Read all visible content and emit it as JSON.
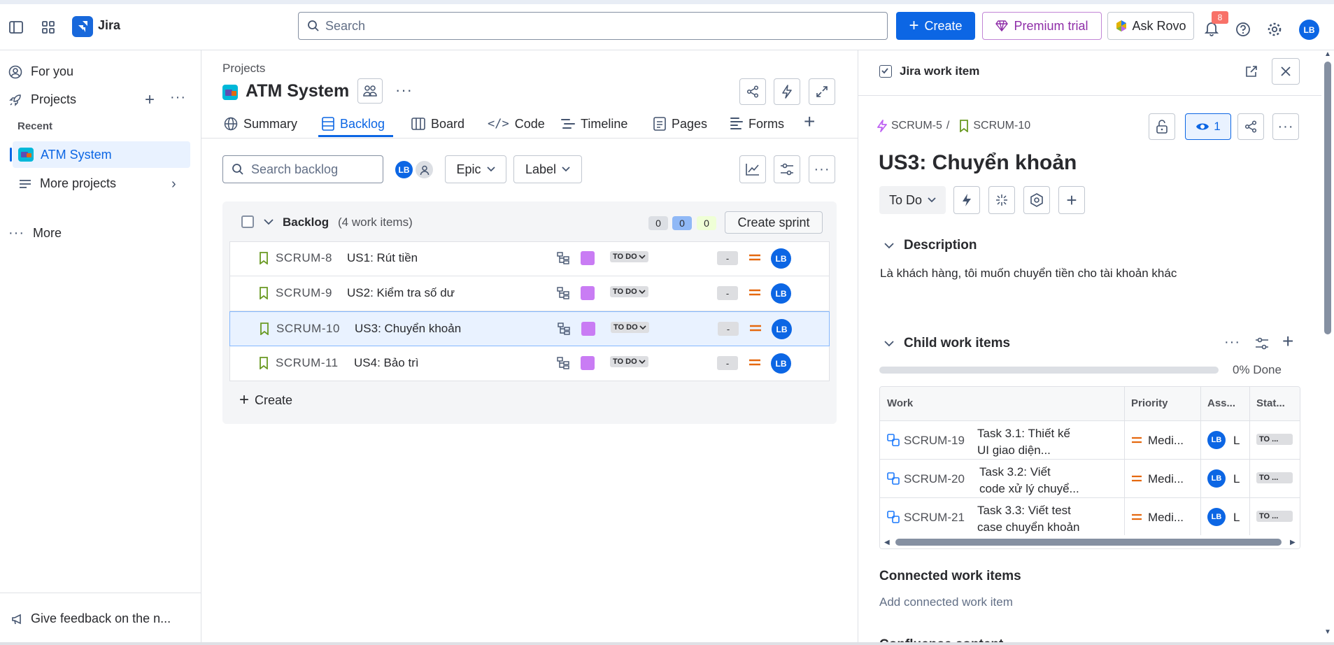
{
  "topbar": {
    "app_name": "Jira",
    "search_placeholder": "Search",
    "create_label": "Create",
    "premium_label": "Premium trial",
    "rovo_label": "Ask Rovo",
    "notif_count": "8",
    "avatar": "LB"
  },
  "sidebar": {
    "for_you": "For you",
    "projects": "Projects",
    "recent": "Recent",
    "atm_system": "ATM System",
    "more_projects": "More projects",
    "more": "More",
    "feedback": "Give feedback on the n..."
  },
  "main": {
    "breadcrumb": "Projects",
    "project_title": "ATM System",
    "tabs": [
      "Summary",
      "Backlog",
      "Board",
      "Code",
      "Timeline",
      "Pages",
      "Forms"
    ],
    "search_backlog": "Search backlog",
    "epic": "Epic",
    "label": "Label",
    "backlog_title": "Backlog",
    "backlog_count": "(4 work items)",
    "counts": [
      "0",
      "0",
      "0"
    ],
    "create_sprint": "Create sprint",
    "create": "Create",
    "rows": [
      {
        "key": "SCRUM-8",
        "title": "US1: Rút tiền",
        "status": "TO DO",
        "est": "-",
        "avatar": "LB"
      },
      {
        "key": "SCRUM-9",
        "title": "US2: Kiểm tra số dư",
        "status": "TO DO",
        "est": "-",
        "avatar": "LB"
      },
      {
        "key": "SCRUM-10",
        "title": "US3: Chuyển khoản",
        "status": "TO DO",
        "est": "-",
        "avatar": "LB"
      },
      {
        "key": "SCRUM-11",
        "title": "US4: Bảo trì",
        "status": "TO DO",
        "est": "-",
        "avatar": "LB"
      }
    ]
  },
  "panel": {
    "header": "Jira work item",
    "parent_key": "SCRUM-5",
    "separator": "/",
    "item_key": "SCRUM-10",
    "watchers": "1",
    "title": "US3: Chuyển khoản",
    "status": "To Do",
    "description_heading": "Description",
    "description": "Là khách hàng, tôi muốn chuyển tiền cho tài khoản khác",
    "child_heading": "Child work items",
    "progress_label": "0% Done",
    "progress": 0,
    "columns": [
      "Work",
      "Priority",
      "Ass...",
      "Stat..."
    ],
    "children": [
      {
        "key": "SCRUM-19",
        "line1": "Task 3.1: Thiết kế",
        "line2": "UI giao diện...",
        "priority": "Medi...",
        "avatar": "LB",
        "assignee": "L",
        "status": "TO ..."
      },
      {
        "key": "SCRUM-20",
        "line1": "Task 3.2: Viết",
        "line2": "code xử lý chuyể...",
        "priority": "Medi...",
        "avatar": "LB",
        "assignee": "L",
        "status": "TO ..."
      },
      {
        "key": "SCRUM-21",
        "line1": "Task 3.3: Viết test",
        "line2": "case chuyển khoản",
        "priority": "Medi...",
        "avatar": "LB",
        "assignee": "L",
        "status": "TO ..."
      }
    ],
    "connected_heading": "Connected work items",
    "add_connected": "Add connected work item",
    "confluence_heading": "Confluence content"
  },
  "colors": {
    "accent": "#0c66e4",
    "premium": "#8f2ea8",
    "selected_row": "#e9f2ff",
    "story_green": "#6a9a23",
    "epic_purple": "#c97cf4",
    "priority_orange": "#e56910"
  }
}
